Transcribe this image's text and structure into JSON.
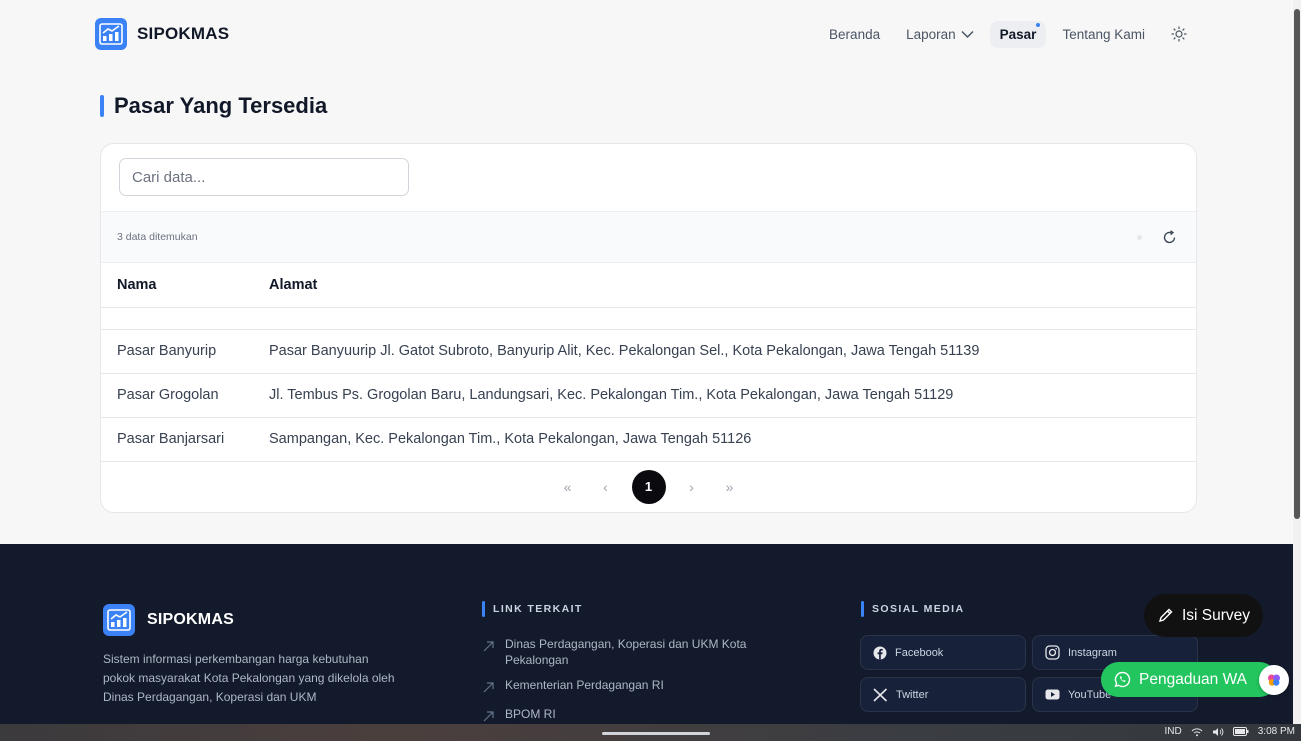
{
  "app": {
    "name": "SIPOKMAS"
  },
  "nav": {
    "items": [
      {
        "label": "Beranda"
      },
      {
        "label": "Laporan"
      },
      {
        "label": "Pasar"
      },
      {
        "label": "Tentang Kami"
      }
    ],
    "active": "Pasar",
    "theme_icon": "sun-icon"
  },
  "page": {
    "title": "Pasar Yang Tersedia"
  },
  "search": {
    "placeholder": "Cari data...",
    "value": ""
  },
  "results": {
    "count_text": "3 data ditemukan"
  },
  "table": {
    "columns": [
      "Nama",
      "Alamat"
    ],
    "rows": [
      {
        "nama": "Pasar Banyurip",
        "alamat": "Pasar Banyuurip Jl. Gatot Subroto, Banyurip Alit, Kec. Pekalongan Sel., Kota Pekalongan, Jawa Tengah 51139"
      },
      {
        "nama": "Pasar Grogolan",
        "alamat": "Jl. Tembus Ps. Grogolan Baru, Landungsari, Kec. Pekalongan Tim., Kota Pekalongan, Jawa Tengah 51129"
      },
      {
        "nama": "Pasar Banjarsari",
        "alamat": "Sampangan, Kec. Pekalongan Tim., Kota Pekalongan, Jawa Tengah 51126"
      }
    ]
  },
  "pagination": {
    "first": "«",
    "prev": "‹",
    "current": "1",
    "next": "›",
    "last": "»"
  },
  "footer": {
    "brand": "SIPOKMAS",
    "description": "Sistem informasi perkembangan harga kebutuhan pokok masyarakat Kota Pekalongan yang dikelola oleh Dinas Perdagangan, Koperasi dan UKM",
    "links_title": "LINK TERKAIT",
    "links": [
      "Dinas Perdagangan, Koperasi dan UKM Kota Pekalongan",
      "Kementerian Perdagangan RI",
      "BPOM RI"
    ],
    "social_title": "SOSIAL MEDIA",
    "social": [
      {
        "label": "Facebook",
        "icon": "facebook-icon"
      },
      {
        "label": "Instagram",
        "icon": "instagram-icon"
      },
      {
        "label": "Twitter",
        "icon": "x-twitter-icon"
      },
      {
        "label": "YouTube",
        "icon": "youtube-icon"
      }
    ]
  },
  "floating": {
    "survey_label": "Isi Survey",
    "whatsapp_label": "Pengaduan WA"
  },
  "taskbar": {
    "language": "IND",
    "time": "3:08 PM"
  },
  "colors": {
    "accent": "#3b82f6",
    "footer_bg": "#131a2b",
    "whatsapp": "#22c55e",
    "dark_button": "#111111"
  }
}
